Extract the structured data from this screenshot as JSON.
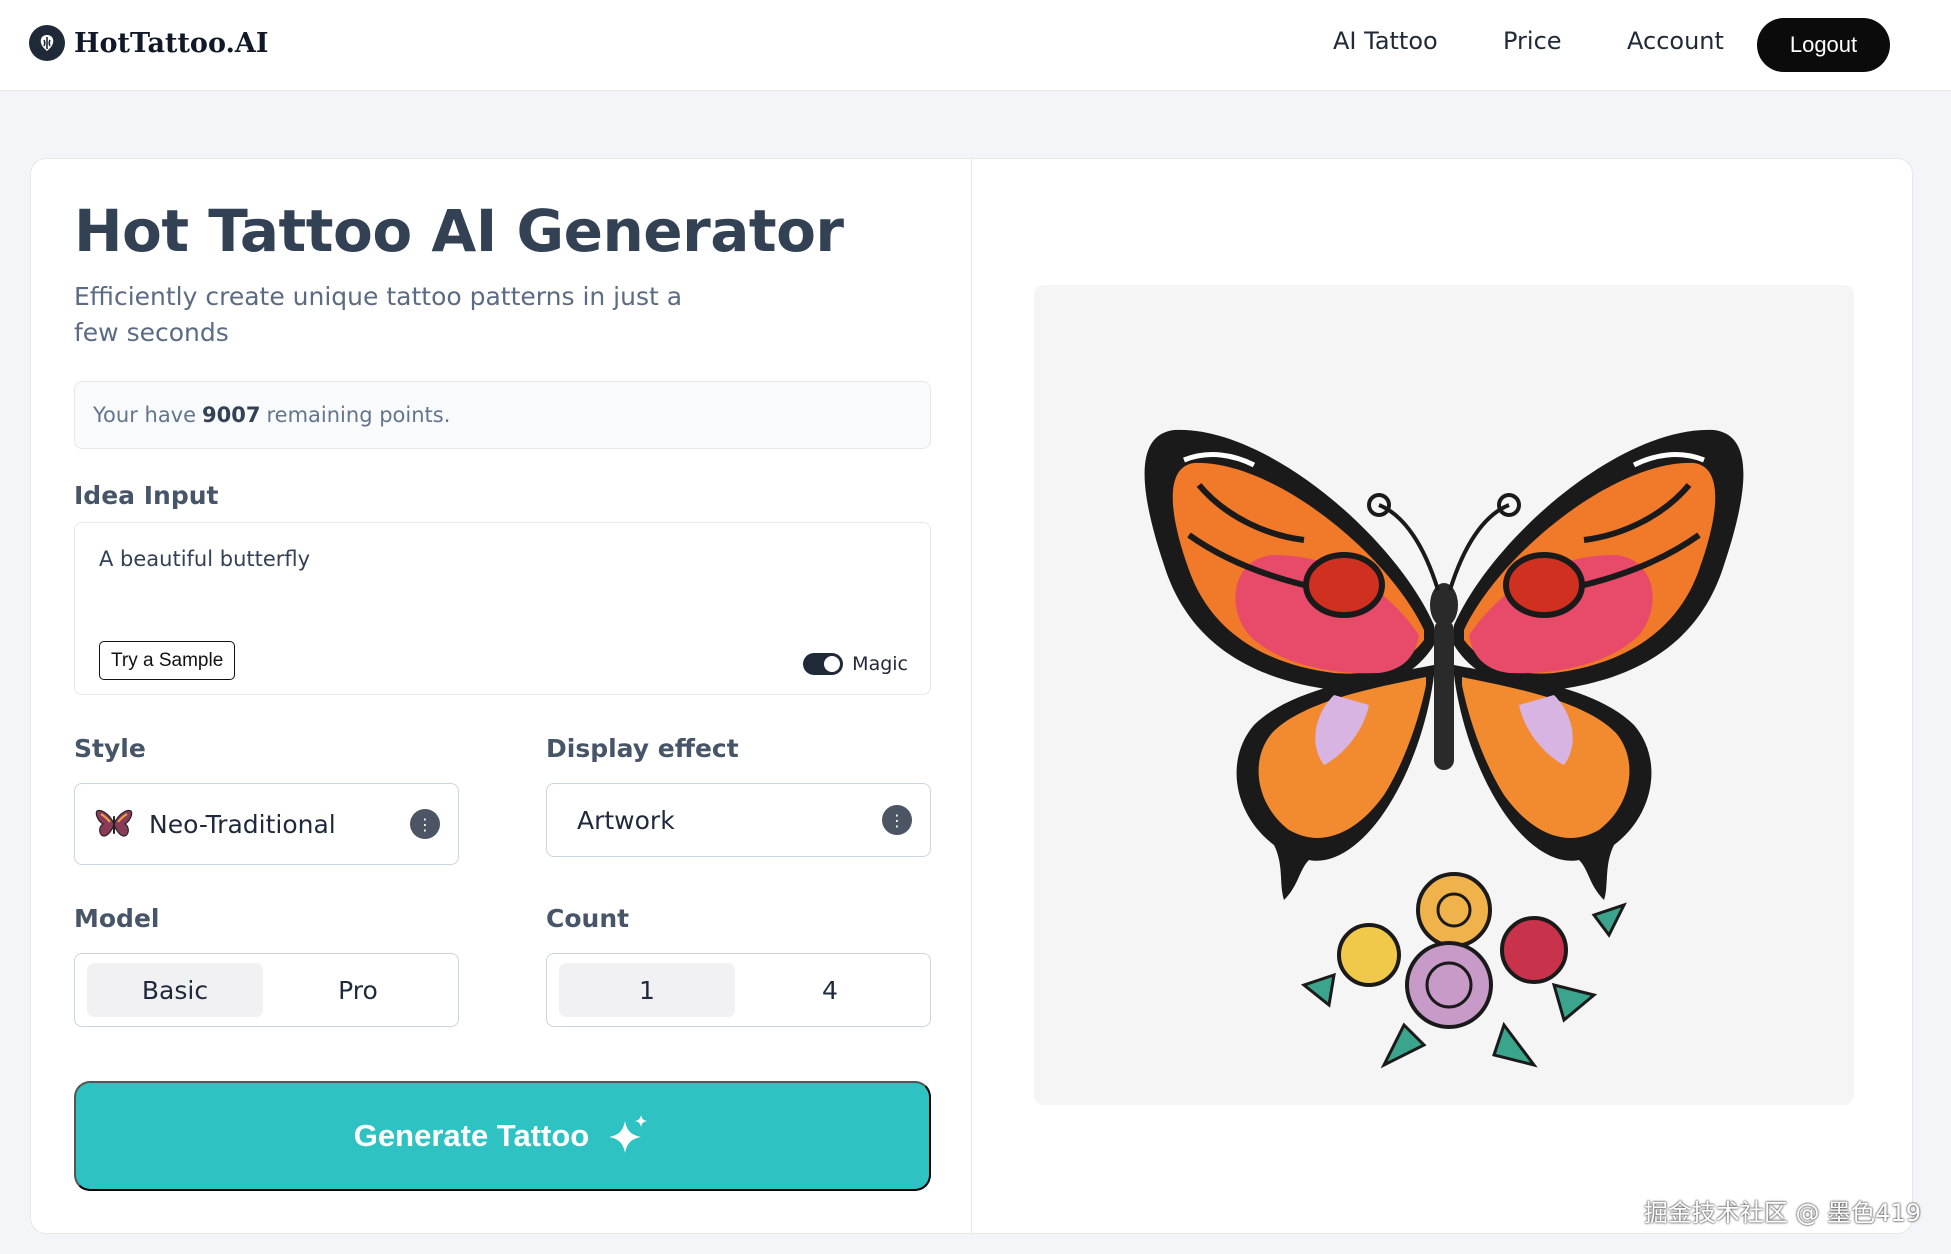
{
  "brand": {
    "name": "HotTattoo.AI"
  },
  "nav": {
    "ai_tattoo": "AI Tattoo",
    "price": "Price",
    "account": "Account",
    "logout": "Logout"
  },
  "generator": {
    "title": "Hot Tattoo AI Generator",
    "subtitle": "Efficiently create unique tattoo patterns in just a few seconds",
    "points_prefix": "Your have",
    "points_value": "9007",
    "points_suffix": "remaining points.",
    "idea_label": "Idea Input",
    "idea_value": "A beautiful butterfly",
    "try_sample": "Try a Sample",
    "magic_label": "Magic",
    "magic_on": true,
    "style_label": "Style",
    "style_value": "Neo-Traditional",
    "display_label": "Display effect",
    "display_value": "Artwork",
    "model_label": "Model",
    "model_options": [
      "Basic",
      "Pro"
    ],
    "model_selected": "Basic",
    "count_label": "Count",
    "count_options": [
      "1",
      "4"
    ],
    "count_selected": "1",
    "generate_label": "Generate Tattoo"
  },
  "preview": {
    "image": "butterfly-tattoo-image"
  },
  "watermark": "掘金技术社区 @ 墨色419",
  "colors": {
    "accent": "#2ec2c2",
    "logout_bg": "#0b0b0b",
    "title": "#334155"
  }
}
